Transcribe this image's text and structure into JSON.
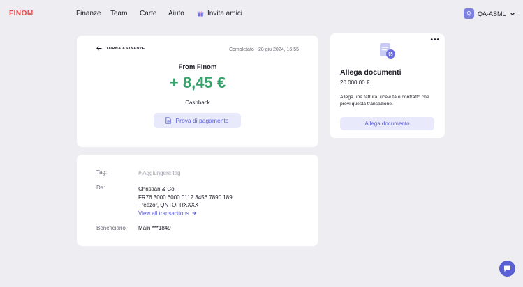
{
  "brand": {
    "logo": "FINOM"
  },
  "nav": {
    "items": [
      "Finanze",
      "Team",
      "Carte",
      "Aiuto"
    ],
    "invite": "Invita amici"
  },
  "user": {
    "initial": "Q",
    "name": "QA-ASML"
  },
  "transaction": {
    "back_label": "TORNA A FINANZE",
    "status": "Completato - 28 giu 2024, 16:55",
    "from": "From Finom",
    "amount": "+ 8,45 €",
    "category": "Cashback",
    "proof_button": "Prova di pagamento"
  },
  "details": {
    "tag_label": "Tag:",
    "tag_placeholder": "# Aggiungere tag",
    "from_label": "Da:",
    "from_name": "Christian & Co.",
    "from_iban": "FR76 3000 6000 0112 3456 7890 189",
    "from_bank": "Treezor, QNTOFRXXXX",
    "view_all": "View all transactions",
    "beneficiary_label": "Beneficiario:",
    "beneficiary_value": "Main ***1849"
  },
  "attach": {
    "title": "Allega documenti",
    "amount": "20.000,00 €",
    "description": "Allega una fattura, ricevuta o contratto che provi questa transazione.",
    "button": "Allega documento",
    "menu": "•••"
  },
  "colors": {
    "accent": "#5b5fd6",
    "positive": "#34a36a",
    "logo": "#e5484d",
    "background": "#eeeef2"
  },
  "icons": [
    "gift-icon",
    "chevron-down-icon",
    "arrow-left-icon",
    "document-icon",
    "arrow-right-icon",
    "attach-document-icon",
    "chat-icon"
  ]
}
